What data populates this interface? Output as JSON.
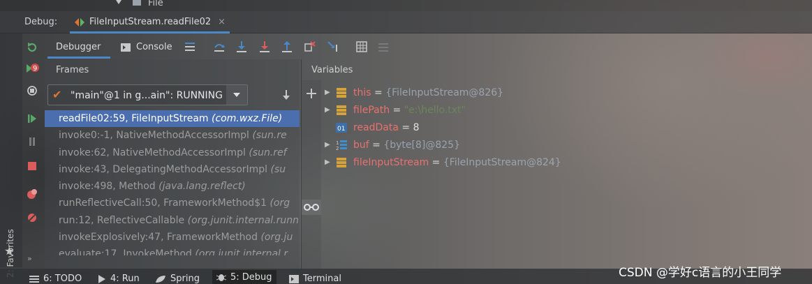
{
  "top_tree": {
    "label": "File"
  },
  "debug_bar": {
    "title": "Debug:",
    "tab_label": "FileInputStream.readFile02",
    "tab_close": "×"
  },
  "subtabs": {
    "debugger": "Debugger",
    "console": "Console"
  },
  "panels": {
    "frames_header": "Frames",
    "variables_header": "Variables"
  },
  "thread": {
    "selected": "\"main\"@1 in g...ain\": RUNNING"
  },
  "frames": [
    {
      "method": "readFile02:59, FileInputStream",
      "package": "(com.wxz.File)",
      "selected": true
    },
    {
      "method": "invoke0:-1, NativeMethodAccessorImpl",
      "package": "(sun.re"
    },
    {
      "method": "invoke:62, NativeMethodAccessorImpl",
      "package": "(sun.ref"
    },
    {
      "method": "invoke:43, DelegatingMethodAccessorImpl",
      "package": "(su"
    },
    {
      "method": "invoke:498, Method",
      "package": "(java.lang.reflect)"
    },
    {
      "method": "runReflectiveCall:50, FrameworkMethod$1",
      "package": "(org"
    },
    {
      "method": "run:12, ReflectiveCallable",
      "package": "(org.junit.internal.runn"
    },
    {
      "method": "invokeExplosively:47, FrameworkMethod",
      "package": "(org.ju"
    },
    {
      "method": "evaluate:17, InvokeMethod",
      "package": "(org.junit.internal.r"
    }
  ],
  "variables": [
    {
      "name": "this",
      "eq": " = ",
      "value": "{FileInputStream@826}",
      "kind": "object",
      "expandable": true
    },
    {
      "name": "filePath",
      "eq": " = ",
      "value": "\"e:\\hello.txt\"",
      "kind": "string",
      "expandable": true
    },
    {
      "name": "readData",
      "eq": " = ",
      "value": "8",
      "kind": "primitive",
      "expandable": false
    },
    {
      "name": "buf",
      "eq": " = ",
      "value": "{byte[8]@825}",
      "kind": "array",
      "expandable": true
    },
    {
      "name": "fileInputStream",
      "eq": " = ",
      "value": "{FileInputStream@824}",
      "kind": "object",
      "expandable": true
    }
  ],
  "left_toolbar": {
    "favorites": "2: Favorites"
  },
  "bottom_tabs": [
    {
      "label": "6: TODO"
    },
    {
      "label": "4: Run"
    },
    {
      "label": "Spring"
    },
    {
      "label": "5: Debug",
      "active": true
    },
    {
      "label": "Terminal"
    }
  ],
  "watermark": "CSDN @学好c语言的小王同学",
  "colors": {
    "accent": "#4a88c7",
    "selection": "#4b6eaf",
    "var_name": "#e9716e",
    "string": "#6a8759"
  },
  "icons": [
    "rerun-icon",
    "resume-icon",
    "pause-icon",
    "stop-icon",
    "view-breakpoints-icon",
    "mute-breakpoints-icon",
    "step-over-icon",
    "step-into-icon",
    "force-step-into-icon",
    "step-out-icon",
    "evaluate-icon",
    "glasses-icon"
  ]
}
